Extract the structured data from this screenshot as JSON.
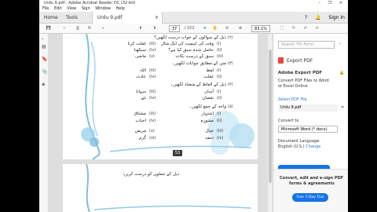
{
  "window": {
    "title": "Urdu 9.pdf - Adobe Acrobat Reader DC (32-bit)",
    "controls": "– ❐ ✕"
  },
  "menu": [
    "File",
    "Edit",
    "View",
    "Sign",
    "Window",
    "Help"
  ],
  "tabs": {
    "home": "Home",
    "tools": "Tools",
    "doc": "Urdu 9.pdf",
    "close": "×"
  },
  "header_right": {
    "help": "?",
    "sign_in": "Sign In"
  },
  "toolbar": {
    "current_page": "37",
    "total_pages": "/ 152",
    "zoom": "83.1%"
  },
  "page_badge": "53",
  "page_lines": [
    {
      "marker": "(۲)",
      "text": "ذیل کے سوالوں کے جواب درست لکھیں؟"
    },
    {
      "marker": "(i)",
      "text": "وقت کی اہمیت کی ایک مثال"
    },
    {
      "marker": "(ii)",
      "text": "حاصل شدہ سبق کیا ہے؟"
    },
    {
      "marker": "(iii)",
      "text": "سبق کے درست نکات"
    },
    {
      "marker": "(۳)",
      "text": "متن کے مطابق جوابات لکھیں۔"
    },
    {
      "marker": "(i)",
      "text": "لفظ"
    },
    {
      "marker": "(ii)",
      "text": "غفلت"
    },
    {
      "marker": "(۴)",
      "text": "ذیل کے الفاظ کے متضاد لکھیں۔"
    },
    {
      "marker": "(i)",
      "text": "آسان"
    },
    {
      "marker": "(ii)",
      "text": "نقصان"
    },
    {
      "marker": "(۵)",
      "text": "واحد کے جمع لکھیں۔"
    },
    {
      "marker": "(i)",
      "text": "اشتہار"
    },
    {
      "marker": "(ii)",
      "text": "مشورہ"
    },
    {
      "marker": "(iii)",
      "text": "خیال"
    },
    {
      "marker": "(iv)",
      "text": "تحفہ"
    }
  ],
  "page_left_lines": [
    {
      "marker": "(iii)",
      "text": "غفلت کرنا"
    },
    {
      "marker": "(iv)",
      "text": "سیکھنا"
    },
    {
      "marker": "(v)",
      "text": "ماضی"
    },
    {
      "marker": "(iii)",
      "text": "اللہ"
    },
    {
      "marker": "(iv)",
      "text": "عادت"
    },
    {
      "marker": "(iii)",
      "text": "سہانا"
    },
    {
      "marker": "(iv)",
      "text": "نئے"
    },
    {
      "marker": "(iii)",
      "text": "مشتاق"
    },
    {
      "marker": "(iv)",
      "text": "احباب"
    },
    {
      "marker": "(v)",
      "text": "مریض"
    },
    {
      "marker": "(vi)",
      "text": "گرم"
    }
  ],
  "page2_line": "ذیل کے جملوں کو درست کریں:",
  "right_panel": {
    "search_placeholder": "Search 'Fill Form'",
    "export_heading": "Export PDF",
    "adobe_export": "Adobe Export PDF",
    "desc1": "Convert PDF Files to Word",
    "desc2": "or Excel Online",
    "select_file": "Select PDF File",
    "file_name": "Urdu 9.pdf",
    "convert_to_label": "Convert to",
    "convert_to_value": "Microsoft Word (*.docx)",
    "doc_lang_label": "Document Language:",
    "doc_lang_value": "English (U.S.)",
    "change": "Change",
    "promo1": "Convert, edit and e-sign PDF",
    "promo2": "forms & agreements",
    "trial": "Free 7-Day Trial"
  },
  "colors": {
    "accent": "#1473e6",
    "export_red": "#e8453c",
    "flower": "#8ec9e8"
  }
}
